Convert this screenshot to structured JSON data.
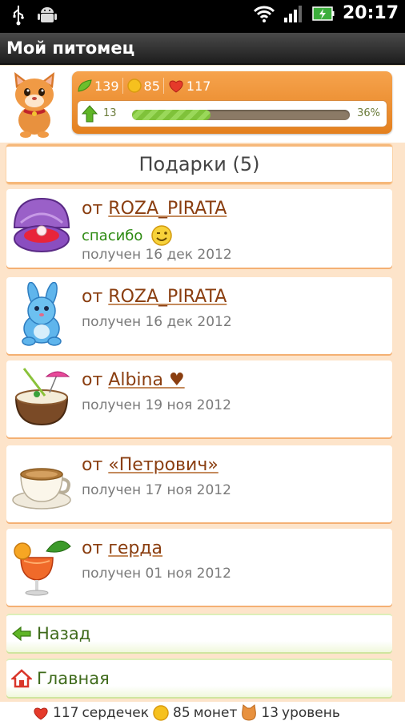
{
  "status_bar": {
    "time": "20:17"
  },
  "app": {
    "title": "Мой питомец"
  },
  "stats": {
    "leaves": "139",
    "coins": "85",
    "hearts": "117",
    "level": "13",
    "level_percent": "36%",
    "level_progress": 0.36
  },
  "gifts": {
    "header": "Подарки (5)",
    "items": [
      {
        "prefix": "от",
        "sender": "ROZA_PIRATA",
        "note": "спасибо",
        "date": "получен 16 дек 2012",
        "icon": "pearl-shell-icon"
      },
      {
        "prefix": "от",
        "sender": "ROZA_PIRATA",
        "date": "получен 16 дек 2012",
        "icon": "blue-bunny-icon"
      },
      {
        "prefix": "от",
        "sender": "Albina ♥",
        "date": "получен 19 ноя 2012",
        "icon": "coconut-cocktail-icon"
      },
      {
        "prefix": "от",
        "sender": "«Петрович»",
        "date": "получен 17 ноя 2012",
        "icon": "coffee-cup-icon"
      },
      {
        "prefix": "от",
        "sender": "герда",
        "date": "получен 01 ноя 2012",
        "icon": "orange-cocktail-icon"
      }
    ]
  },
  "nav": {
    "back": "Назад",
    "home": "Главная"
  },
  "footer": {
    "hearts_count": "117",
    "hearts_label": "сердечек",
    "coins_count": "85",
    "coins_label": "монет",
    "level_count": "13",
    "level_label": "уровень"
  }
}
